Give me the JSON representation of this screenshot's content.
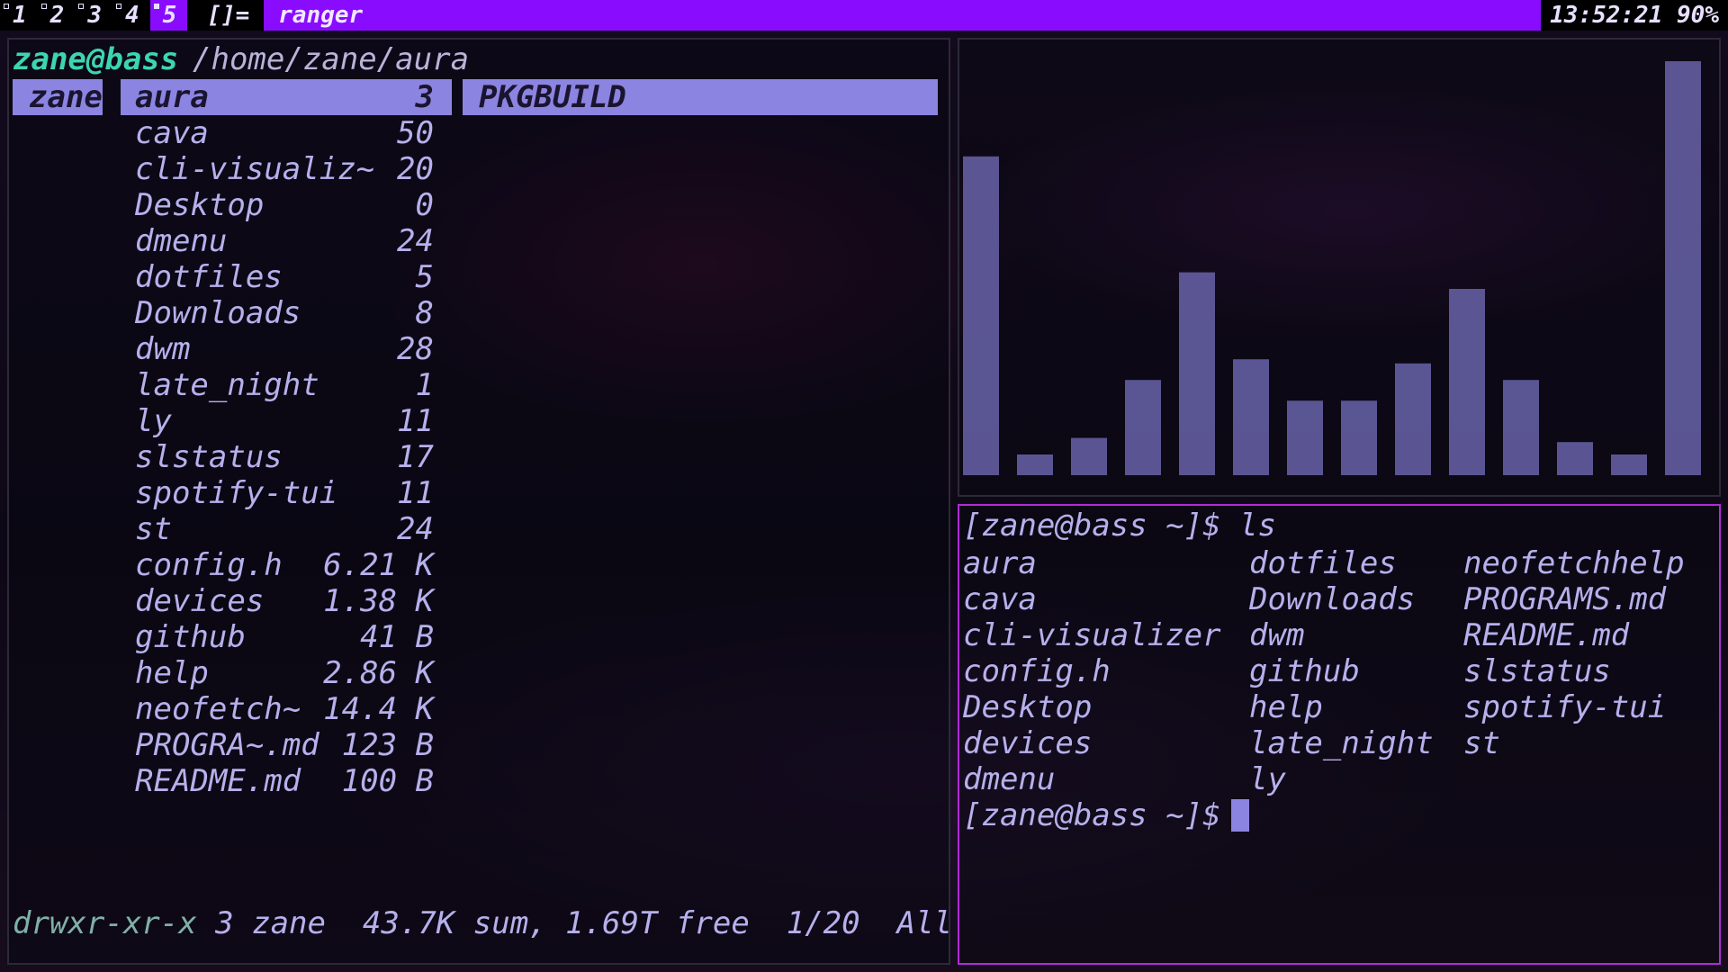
{
  "bar": {
    "tags": [
      "1",
      "2",
      "3",
      "4",
      "5"
    ],
    "active_tag": "5",
    "layout": "[]=",
    "title": "ranger",
    "clock": "13:52:21",
    "battery": "90%"
  },
  "ranger": {
    "user_host": "zane@bass",
    "path": "/home/zane/aura",
    "parent_selected": "zane",
    "entries": [
      {
        "name": "aura",
        "size": "3"
      },
      {
        "name": "cava",
        "size": "50"
      },
      {
        "name": "cli-visualiz~",
        "size": "20"
      },
      {
        "name": "Desktop",
        "size": "0"
      },
      {
        "name": "dmenu",
        "size": "24"
      },
      {
        "name": "dotfiles",
        "size": "5"
      },
      {
        "name": "Downloads",
        "size": "8"
      },
      {
        "name": "dwm",
        "size": "28"
      },
      {
        "name": "late_night",
        "size": "1"
      },
      {
        "name": "ly",
        "size": "11"
      },
      {
        "name": "slstatus",
        "size": "17"
      },
      {
        "name": "spotify-tui",
        "size": "11"
      },
      {
        "name": "st",
        "size": "24"
      },
      {
        "name": "config.h",
        "size": "6.21 K"
      },
      {
        "name": "devices",
        "size": "1.38 K"
      },
      {
        "name": "github",
        "size": "41 B"
      },
      {
        "name": "help",
        "size": "2.86 K"
      },
      {
        "name": "neofetch~",
        "size": "14.4 K"
      },
      {
        "name": "PROGRA~.md",
        "size": "123 B"
      },
      {
        "name": "README.md",
        "size": "100 B"
      }
    ],
    "preview_selected": "PKGBUILD",
    "footer_perm": "drwxr-xr-x",
    "footer_info": " 3 zane  43.7K sum, 1.69T free  1/20  All"
  },
  "cava": {
    "bar_color": "#8b84e0",
    "levels": [
      0.77,
      0.05,
      0.09,
      0.23,
      0.49,
      0.28,
      0.18,
      0.18,
      0.27,
      0.45,
      0.23,
      0.08,
      0.05,
      1.0
    ]
  },
  "terminal": {
    "prompt": "[zane@bass ~]$",
    "command": " ls",
    "columns": [
      [
        "aura",
        "cava",
        "cli-visualizer",
        "config.h",
        "Desktop",
        "devices",
        "dmenu"
      ],
      [
        "dotfiles",
        "Downloads",
        "dwm",
        "github",
        "help",
        "late_night",
        "ly"
      ],
      [
        "neofetchhelp",
        "PROGRAMS.md",
        "README.md",
        "slstatus",
        "spotify-tui",
        "st"
      ]
    ],
    "prompt2": "[zane@bass ~]$"
  }
}
